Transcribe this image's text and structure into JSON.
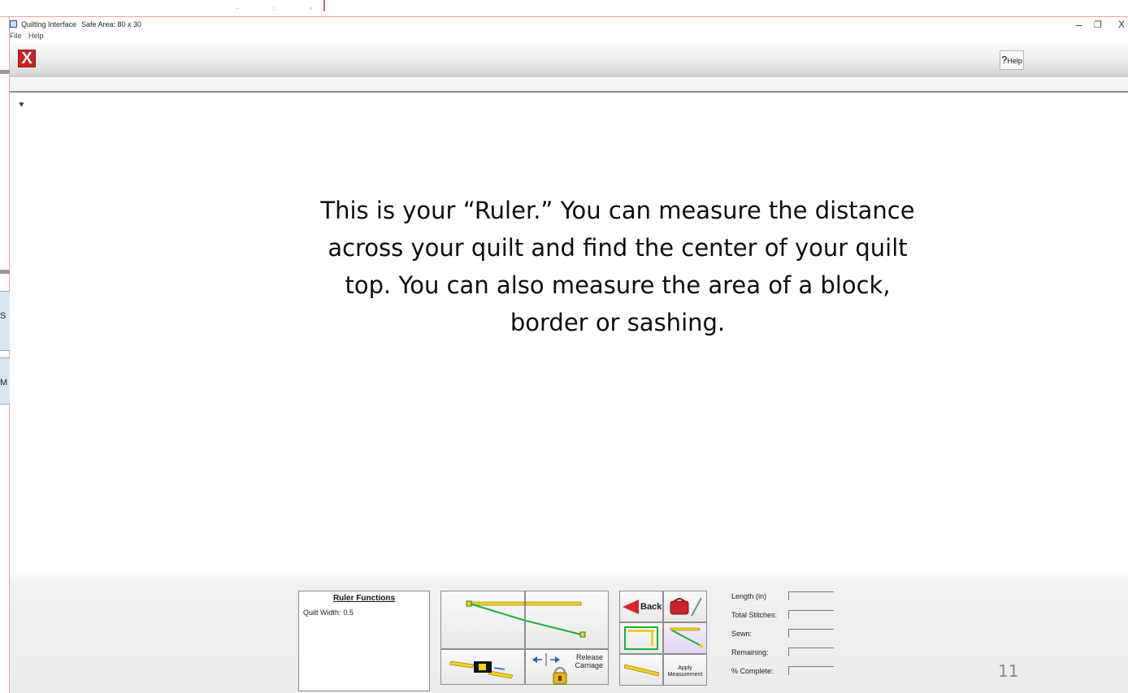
{
  "window": {
    "title": "Quilting Interface",
    "safe_area": "Safe Area: 80 x 30",
    "controls": {
      "minimize": "–",
      "restore": "❐",
      "close": "X"
    },
    "ghost_controls": {
      "minimize": "–",
      "restore": "□",
      "close": "×"
    }
  },
  "menu": {
    "items": [
      "File",
      "Help"
    ]
  },
  "toolbar": {
    "close_symbol": "X",
    "help_glyph": "?",
    "help_label": "Help"
  },
  "left_edge": {
    "btn1_text": "S",
    "btn2_text": "M"
  },
  "slide": {
    "annotation_line1": "This is your “Ruler.”  You can measure the distance",
    "annotation_line2": "across your quilt and find the center of your quilt",
    "annotation_line3": "top.  You can also measure the area of a block,",
    "annotation_line4": "border or sashing.",
    "page_number": "11"
  },
  "ruler_functions": {
    "title": "Ruler Functions",
    "quilt_width_label": "Quilt Width:",
    "quilt_width_value": "0.5"
  },
  "buttons": {
    "release_line1": "Release",
    "release_line2": "Carriage",
    "back_label": "Back",
    "apply_line1": "Apply",
    "apply_line2": "Measurement"
  },
  "stats": {
    "labels": [
      "Length (in)",
      "Total Stitches:",
      "Sewn:",
      "Remaining:",
      "% Complete:"
    ]
  },
  "colors": {
    "close_red": "#c8232a",
    "ruler_yellow": "#f2d21b",
    "measure_green": "#1fae3a",
    "back_red": "#d6262e"
  }
}
